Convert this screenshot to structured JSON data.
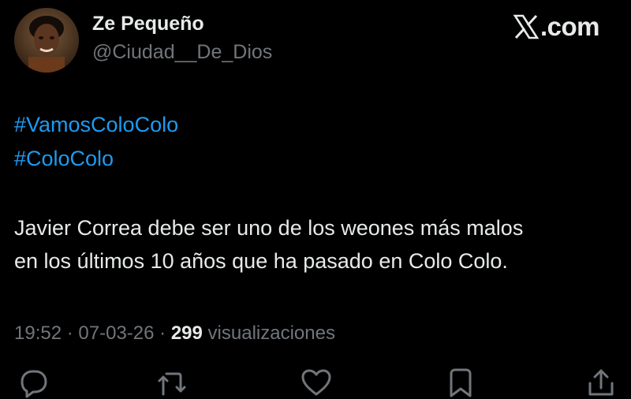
{
  "post": {
    "author": {
      "display_name": "Ze Pequeño",
      "handle": "@Ciudad__De_Dios"
    },
    "brand": {
      "text": ".com",
      "icon": "x-logo-icon"
    },
    "hashtags": [
      "#VamosColoColo",
      "#ColoColo"
    ],
    "body_lines": [
      "Javier Correa debe ser uno de los weones más malos",
      "en los últimos 10 años que ha pasado en Colo Colo."
    ],
    "meta": {
      "time": "19:52",
      "date": "07-03-26",
      "separator": "·",
      "views_count": "299",
      "views_label": "visualizaciones"
    },
    "actions": {
      "reply_icon": "reply-icon",
      "repost_icon": "repost-icon",
      "like_icon": "heart-icon",
      "bookmark_icon": "bookmark-icon",
      "share_icon": "share-icon"
    },
    "colors": {
      "background": "#000000",
      "text": "#e7e9ea",
      "secondary": "#71767b",
      "link": "#1d9bf0"
    }
  }
}
